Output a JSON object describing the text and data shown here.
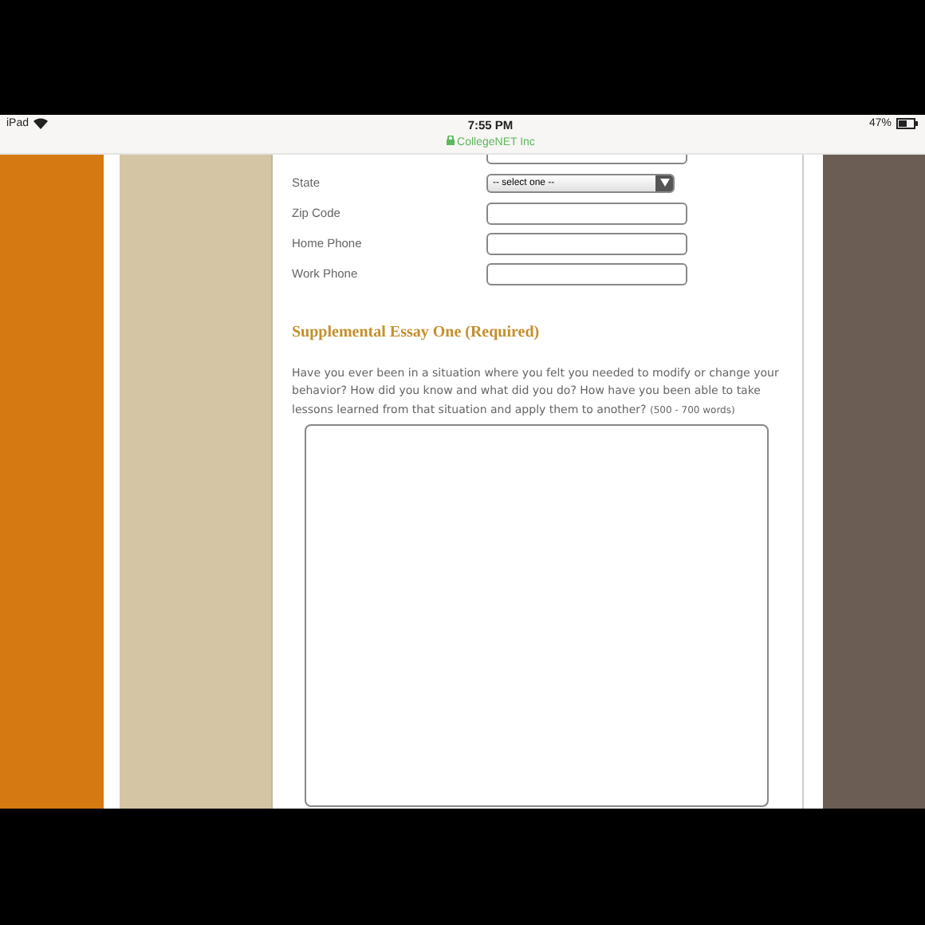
{
  "status_bar": {
    "device": "iPad",
    "time": "7:55 PM",
    "site": "CollegeNET Inc",
    "battery": "47%"
  },
  "form": {
    "fields": [
      {
        "kind": "text"
      },
      {
        "kind": "select",
        "label": "State",
        "placeholder": "-- select one --"
      },
      {
        "kind": "text",
        "label": "Zip Code"
      },
      {
        "kind": "text",
        "label": "Home Phone"
      },
      {
        "kind": "text",
        "label": "Work Phone"
      }
    ],
    "section_title": "Supplemental Essay One (Required)",
    "prompt": "Have you ever been in a situation where you felt you needed to modify or change your behavior? How did you know and what did you do? How have you been able to take lessons learned from that situation and apply them to another?",
    "word_limit": "(500 - 700 words)"
  }
}
